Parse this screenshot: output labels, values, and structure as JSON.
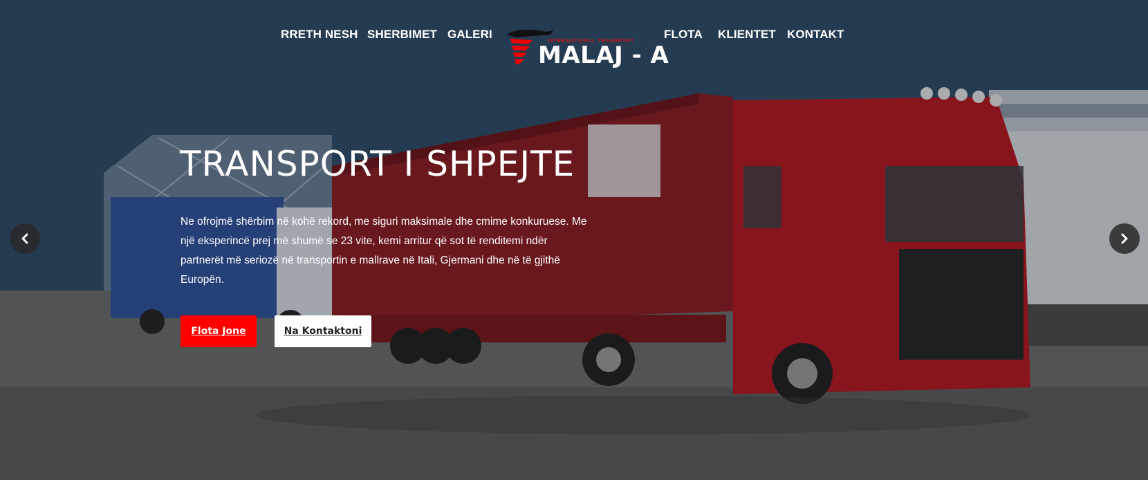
{
  "colors": {
    "accent": "#ff0000",
    "nav_text": "#ffffff",
    "arrow_bg": "#2d2d2d"
  },
  "nav": {
    "items_left": [
      "RRETH NESH",
      "SHERBIMET",
      "GALERI"
    ],
    "items_right": [
      "FLOTA",
      "KLIENTET",
      "KONTAKT"
    ],
    "logo": {
      "subtitle": "INTERNATIONAL TRANSPORT",
      "name": "MALAJ - A"
    }
  },
  "hero": {
    "headline": "TRANSPORT I SHPEJTE",
    "description": "Ne ofrojmë shërbim në kohë rekord, me siguri maksimale dhe cmime konkuruese. Me një eksperincë prej më shumë se 23 vite, kemi arritur që sot të renditemi ndër partnerët më seriozë në transportin e mallrave në Itali, Gjermani dhe në të gjithë Europën.",
    "primary_button": "Flota Jone",
    "secondary_button": "Na Kontaktoni",
    "prev_icon": "chevron-left-icon",
    "next_icon": "chevron-right-icon"
  }
}
